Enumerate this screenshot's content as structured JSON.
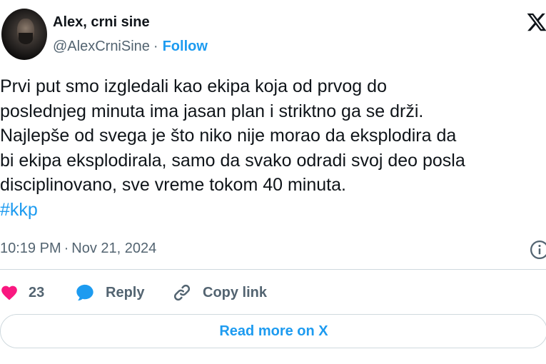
{
  "author": {
    "name": "Alex, crni sine",
    "handle": "@AlexCrniSine",
    "separator": "·",
    "follow_label": "Follow"
  },
  "tweet": {
    "lines": [
      "Prvi put smo izgledali kao ekipa koja od prvog do",
      "poslednjeg minuta ima jasan plan i striktno ga se drži.",
      "Najlepše od svega je što niko nije morao da eksplodira da",
      "bi ekipa eksplodirala, samo da svako odradi svoj deo posla",
      "disciplinovano, sve vreme tokom 40 minuta."
    ],
    "hashtag": "#kkp",
    "time": "10:19 PM",
    "separator": "·",
    "date": "Nov 21, 2024"
  },
  "actions": {
    "like_count": "23",
    "reply_label": "Reply",
    "copy_label": "Copy link"
  },
  "footer": {
    "read_more_label": "Read more on X"
  },
  "colors": {
    "accent": "#1d9bf0",
    "like": "#f91880",
    "text": "#0f1419",
    "muted": "#536471",
    "border": "#cfd9de"
  },
  "icons": [
    "x-logo-icon",
    "info-icon",
    "heart-icon",
    "reply-bubble-icon",
    "link-icon"
  ]
}
